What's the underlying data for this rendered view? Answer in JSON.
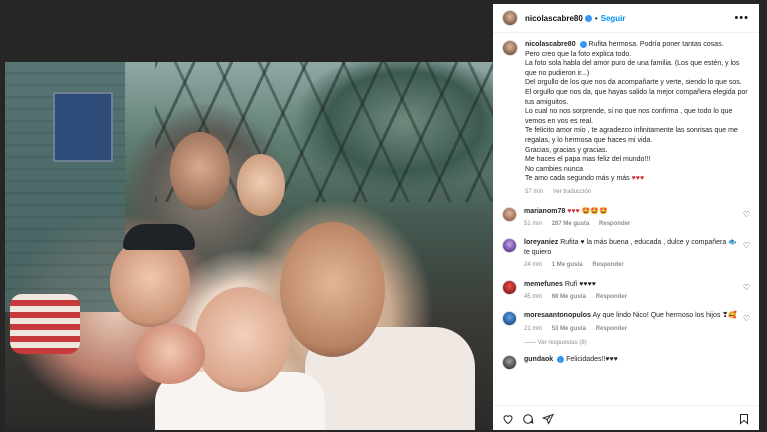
{
  "post": {
    "username": "nicolascabre80",
    "follow_label": "Seguir",
    "more_label": "•••",
    "caption_lines": [
      "Rufita hermosa. Podría poner tantas cosas.",
      "Pero creo que la foto explica todo.",
      "La foto sola habla del amor puro de una familia. (Los que estén, y los que no pudieron ir...)",
      "Del orgullo de los que nos da acompañarte y verte, siendo lo que sos.",
      "El orgullo que nos da, que hayas salido la mejor compañera elegida por tus amiguitos.",
      "Lo cual no nos sorprende, si no que nos confirma , que todo lo que vemos en vos es real.",
      "Te felicito amor mío , te agradezco infinitamente las sonrisas que me regalas, y lo hermosa que haces mi vida.",
      "Gracias, gracias y gracias.",
      "Me haces el papa mas feliz del mundo!!!",
      "No cambies nunca",
      "Te amo cada segundo más y más"
    ],
    "caption_hearts": "♥♥♥",
    "caption_time": "57 min",
    "caption_translate": "Ver traducción"
  },
  "comments": [
    {
      "user": "marianom78",
      "text": "♥♥♥",
      "extra": "🤩🤩🤩",
      "time": "51 min",
      "likes": "287 Me gusta",
      "reply": "Responder"
    },
    {
      "user": "loreyaniez",
      "text": "Rufita ♥ la más buena , educada , dulce y compañera 🐟 te quiero",
      "extra": "",
      "time": "24 min",
      "likes": "1 Me gusta",
      "reply": "Responder"
    },
    {
      "user": "memefunes",
      "text": "Rufi ♥♥♥♥",
      "extra": "",
      "time": "45 min",
      "likes": "68 Me gusta",
      "reply": "Responder"
    },
    {
      "user": "moresaantonopulos",
      "text": "Ay que lindo Nico! Que hermoso los hijos ❣🥰",
      "extra": "",
      "time": "21 min",
      "likes": "53 Me gusta",
      "reply": "Responder"
    },
    {
      "user": "gundaok",
      "text": "Felicidades!!♥♥♥",
      "extra": "",
      "time": "",
      "likes": "",
      "reply": ""
    }
  ],
  "view_replies": "—— Ver respuestas (8)",
  "icons": [
    "heart-icon",
    "comment-icon",
    "share-icon",
    "bookmark-icon"
  ],
  "colors": {
    "link": "#0095f6",
    "verified": "#3897f0",
    "heart": "#d62a3a"
  }
}
